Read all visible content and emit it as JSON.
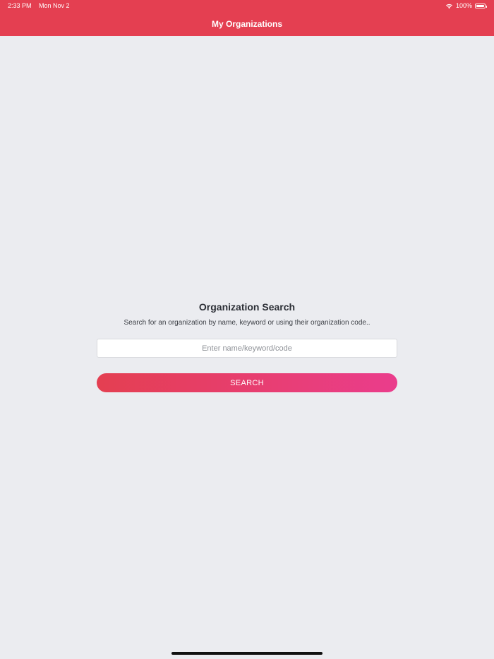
{
  "status_bar": {
    "time": "2:33 PM",
    "date": "Mon Nov 2",
    "battery": "100%",
    "wifi_icon": "wifi-icon",
    "battery_icon": "battery-icon"
  },
  "nav": {
    "title": "My Organizations"
  },
  "search": {
    "title": "Organization Search",
    "subtitle": "Search for an organization by name, keyword or using their organization code..",
    "placeholder": "Enter name/keyword/code",
    "value": "",
    "button_label": "SEARCH"
  },
  "colors": {
    "header": "#e43f51",
    "background": "#ebecf0",
    "button_gradient_start": "#e43f51",
    "button_gradient_end": "#ea3d8c"
  }
}
